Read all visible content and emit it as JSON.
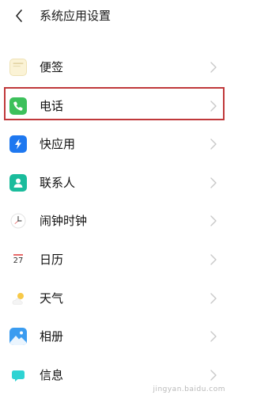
{
  "header": {
    "title": "系统应用设置"
  },
  "list": [
    {
      "label": "便签",
      "icon": "notes-icon"
    },
    {
      "label": "电话",
      "icon": "phone-icon"
    },
    {
      "label": "快应用",
      "icon": "quick-app-icon"
    },
    {
      "label": "联系人",
      "icon": "contacts-icon"
    },
    {
      "label": "闹钟时钟",
      "icon": "clock-icon"
    },
    {
      "label": "日历",
      "icon": "calendar-icon",
      "icon_text": "27"
    },
    {
      "label": "天气",
      "icon": "weather-icon"
    },
    {
      "label": "相册",
      "icon": "gallery-icon"
    },
    {
      "label": "信息",
      "icon": "messages-icon"
    }
  ],
  "colors": {
    "highlight": "#c0393b",
    "phone": "#3cc05b",
    "quick_app": "#1e78f0",
    "contacts": "#1abc9c",
    "gallery": "#3b9cf0",
    "messages": "#2ed3d3"
  },
  "watermark": "jingyan.baidu.com"
}
